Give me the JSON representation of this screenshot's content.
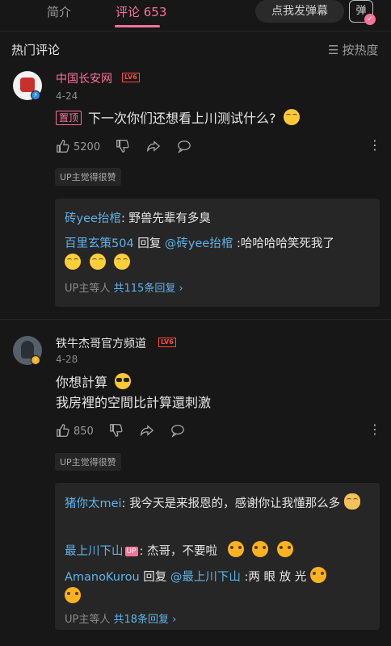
{
  "tabs": [
    {
      "label": "简介",
      "active": false
    },
    {
      "label": "评论 653",
      "active": true
    }
  ],
  "danmu": {
    "button_label": "点我发弹幕",
    "icon_label": "弹"
  },
  "section": {
    "title": "热门评论",
    "sort_label": "按热度"
  },
  "comments": [
    {
      "username": "中国长安网",
      "level": "LV6",
      "date": "4-24",
      "pinned_label": "置顶",
      "text": "下一次你们还想看上川测试什么?",
      "emoji": "smile-emoji",
      "likes": "5200",
      "up_liked": "UP主觉得很赞",
      "replies": [
        {
          "user": "砖yee抬棺",
          "text": ": 野兽先辈有多臭"
        },
        {
          "user": "百里玄策504",
          "middle": " 回复 ",
          "target": "@砖yee抬棺",
          "text": " :哈哈哈哈笑死我了"
        }
      ],
      "more_replies": {
        "prefix": "UP主等人 ",
        "link": "共115条回复"
      }
    },
    {
      "username": "铁牛杰哥官方频道",
      "level": "LV6",
      "date": "4-28",
      "text_line1": "你想計算",
      "text_line2": "我房裡的空間比計算還刺激",
      "emoji": "sunglasses-emoji",
      "likes": "850",
      "up_liked": "UP主觉得很赞",
      "replies": [
        {
          "user": "猪你太mei",
          "text": ": 我今天是来报恩的，感谢你让我懂那么多"
        },
        {
          "user": "最上川下山",
          "badge": "UP",
          "text": ": 杰哥，不要啦"
        },
        {
          "user": "AmanoKurou",
          "middle": " 回复 ",
          "target": "@最上川下山",
          "text": " :两 眼 放 光"
        }
      ],
      "more_replies": {
        "prefix": "UP主等人 ",
        "link": "共18条回复"
      }
    }
  ],
  "colors": {
    "accent": "#fb7299",
    "link": "#5eb3ea",
    "background": "#171717"
  }
}
